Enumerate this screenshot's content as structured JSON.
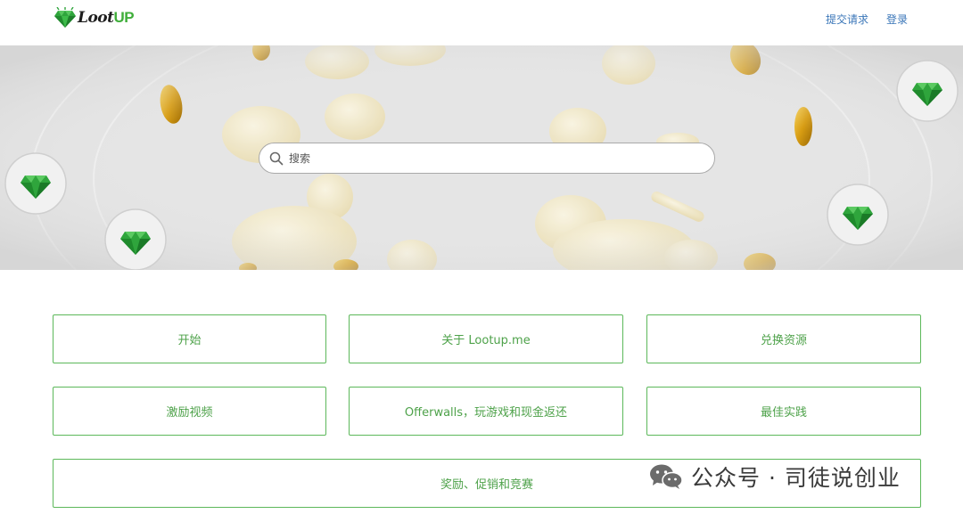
{
  "header": {
    "logo_text_main": "Loot",
    "logo_text_accent": "UP",
    "nav": [
      {
        "label": "提交请求"
      },
      {
        "label": "登录"
      }
    ]
  },
  "search": {
    "placeholder": "搜索",
    "value": ""
  },
  "categories": [
    {
      "label": "开始"
    },
    {
      "label": "关于 Lootup.me"
    },
    {
      "label": "兑换资源"
    },
    {
      "label": "激励视频"
    },
    {
      "label": "Offerwalls，玩游戏和现金返还"
    },
    {
      "label": "最佳实践"
    },
    {
      "label": "奖励、促销和竞赛"
    }
  ],
  "watermark": {
    "text": "公众号 · 司徒说创业",
    "icon": "wechat-icon"
  },
  "colors": {
    "accent_green": "#4ea24a",
    "nav_link": "#3a76b8",
    "hero_bg": "#e4e4e4"
  }
}
